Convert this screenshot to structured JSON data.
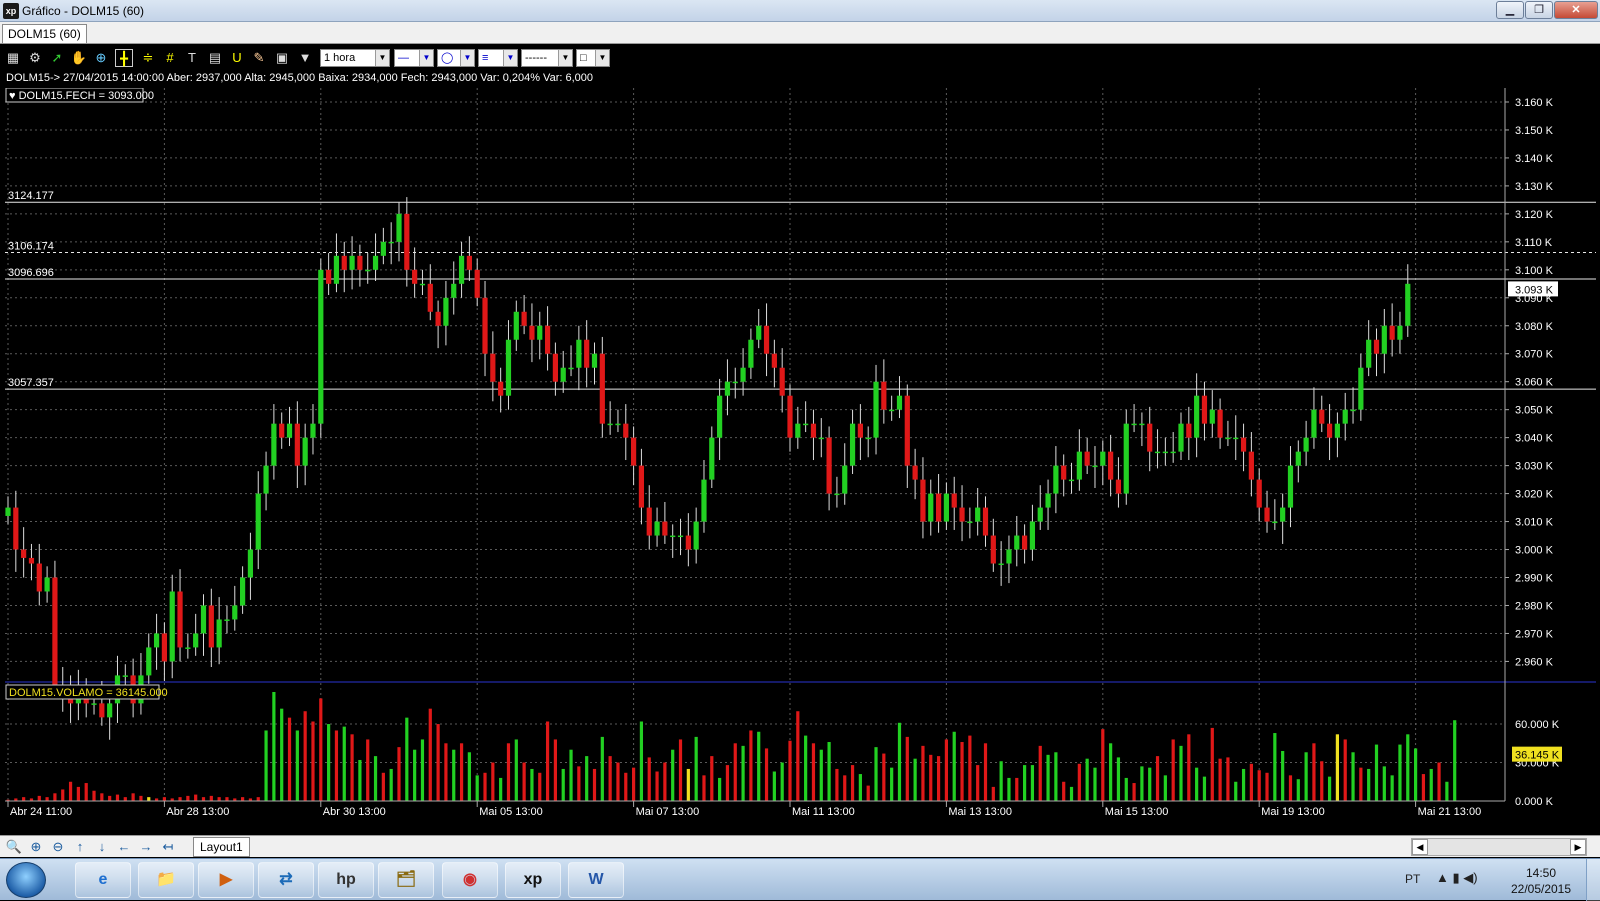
{
  "window": {
    "title": "Gráfico - DOLM15 (60)",
    "app_icon": "xp",
    "min": "▁",
    "max": "❐",
    "close": "✕"
  },
  "tabs": {
    "active": "DOLM15 (60)"
  },
  "toolbar": {
    "icons": [
      "chart-icon",
      "gear-icon",
      "cursor-icon",
      "hand-icon",
      "zoom-area-icon",
      "crosshair-icon",
      "hline-icon",
      "grid-icon",
      "text-icon",
      "calculator-icon",
      "magnet-icon",
      "pencil-icon",
      "lock-icon",
      "filter-icon"
    ],
    "period": "1 hora",
    "line_style": "—",
    "shape": "◯",
    "fill": "≡",
    "dash": "------",
    "color": "□"
  },
  "info_line": "DOLM15-> 27/04/2015 14:00:00 Aber: 2937,000 Alta: 2945,000 Baixa: 2934,000 Fech: 2943,000 Var: 0,204% Var: 6,000",
  "price_legend": "DOLM15.FECH = 3093.000",
  "volume_legend": "DOLM15.VOLAMO = 36145.000",
  "colors": {
    "up": "#22d022",
    "down": "#e01818",
    "neutral": "#f0e020",
    "grid": "#5a5a5a",
    "separator": "#2a34d0"
  },
  "levels": [
    {
      "value": 3124.177,
      "label": "3124.177",
      "style": "solid"
    },
    {
      "value": 3106.174,
      "label": "3106.174",
      "style": "dashed"
    },
    {
      "value": 3096.696,
      "label": "3096.696",
      "style": "solid"
    },
    {
      "value": 3057.357,
      "label": "3057.357",
      "style": "solid"
    }
  ],
  "chart_data": {
    "type": "candlestick",
    "price_axis": {
      "range": [
        2953,
        3165
      ],
      "ticks": [
        2960,
        2970,
        2980,
        2990,
        3000,
        3010,
        3020,
        3030,
        3040,
        3050,
        3060,
        3070,
        3080,
        3090,
        3100,
        3110,
        3120,
        3130,
        3140,
        3150,
        3160
      ],
      "tick_labels": [
        "2.960 K",
        "2.970 K",
        "2.980 K",
        "2.990 K",
        "3.000 K",
        "3.010 K",
        "3.020 K",
        "3.030 K",
        "3.040 K",
        "3.050 K",
        "3.060 K",
        "3.070 K",
        "3.080 K",
        "3.090 K",
        "3.100 K",
        "3.110 K",
        "3.120 K",
        "3.130 K",
        "3.140 K",
        "3.150 K",
        "3.160 K"
      ],
      "current": 3093,
      "current_label": "3.093 K"
    },
    "volume_axis": {
      "range": [
        0,
        85000
      ],
      "ticks": [
        0,
        30000,
        60000
      ],
      "tick_labels": [
        "0.000 K",
        "30.000 K",
        "60.000 K"
      ],
      "current": 36145,
      "current_label": "36.145 K"
    },
    "x_labels": [
      "Abr 24 11:00",
      "Abr 28 13:00",
      "Abr 30 13:00",
      "Mai 05 13:00",
      "Mai 07 13:00",
      "Mai 11 13:00",
      "Mai 13 13:00",
      "Mai 15 13:00",
      "Mai 19 13:00",
      "Mai 21 13:00"
    ],
    "x_label_bars": [
      0,
      20,
      40,
      60,
      80,
      100,
      120,
      140,
      160,
      180
    ],
    "closes": [
      3015,
      3000,
      2997,
      2995,
      2985,
      2990,
      2950,
      2950,
      2945,
      2950,
      2945,
      2945,
      2940,
      2945,
      2955,
      2955,
      2945,
      2955,
      2965,
      2970,
      2960,
      2985,
      2965,
      2965,
      2970,
      2980,
      2965,
      2975,
      2975,
      2980,
      2990,
      3000,
      3020,
      3030,
      3045,
      3040,
      3045,
      3030,
      3040,
      3045,
      3100,
      3095,
      3105,
      3100,
      3105,
      3100,
      3100,
      3105,
      3110,
      3110,
      3120,
      3100,
      3095,
      3095,
      3085,
      3080,
      3090,
      3095,
      3105,
      3100,
      3090,
      3070,
      3060,
      3055,
      3075,
      3085,
      3080,
      3075,
      3080,
      3070,
      3060,
      3065,
      3065,
      3075,
      3065,
      3070,
      3045,
      3045,
      3045,
      3040,
      3030,
      3015,
      3005,
      3010,
      3005,
      3005,
      3005,
      3000,
      3010,
      3025,
      3040,
      3055,
      3060,
      3060,
      3065,
      3075,
      3080,
      3070,
      3065,
      3055,
      3040,
      3045,
      3045,
      3040,
      3040,
      3020,
      3020,
      3030,
      3045,
      3040,
      3040,
      3060,
      3050,
      3050,
      3055,
      3030,
      3025,
      3010,
      3020,
      3010,
      3020,
      3015,
      3010,
      3010,
      3015,
      3005,
      2995,
      2995,
      3000,
      3005,
      3000,
      3010,
      3015,
      3020,
      3030,
      3025,
      3025,
      3035,
      3030,
      3030,
      3035,
      3025,
      3020,
      3045,
      3045,
      3045,
      3035,
      3035,
      3035,
      3035,
      3045,
      3040,
      3055,
      3045,
      3050,
      3040,
      3040,
      3040,
      3035,
      3025,
      3015,
      3010,
      3010,
      3015,
      3030,
      3035,
      3040,
      3050,
      3045,
      3040,
      3045,
      3050,
      3050,
      3065,
      3075,
      3070,
      3080,
      3075,
      3080,
      3095
    ],
    "volumes": [
      1000,
      2000,
      3000,
      2000,
      4000,
      3000,
      6000,
      9000,
      15000,
      11000,
      14000,
      8000,
      6000,
      4000,
      5000,
      3000,
      6000,
      4000,
      3000,
      2000,
      3000,
      2000,
      3000,
      4000,
      5000,
      3000,
      4000,
      3000,
      3000,
      2000,
      3000,
      2000,
      3000,
      55000,
      85000,
      72000,
      65000,
      55000,
      70000,
      62000,
      80000,
      60000,
      55000,
      58000,
      52000,
      32000,
      48000,
      35000,
      22000,
      25000,
      42000,
      65000,
      40000,
      48000,
      72000,
      60000,
      45000,
      40000,
      45000,
      38000,
      20000,
      22000,
      30000,
      18000,
      45000,
      48000,
      30000,
      25000,
      22000,
      62000,
      48000,
      25000,
      40000,
      27000,
      35000,
      25000,
      50000,
      35000,
      30000,
      22000,
      26000,
      62000,
      34000,
      23000,
      30000,
      40000,
      48000,
      25000,
      50000,
      20000,
      35000,
      18000,
      28000,
      45000,
      43000,
      55000,
      54000,
      41000,
      23000,
      30000,
      47000,
      70000,
      51000,
      45000,
      40000,
      46000,
      25000,
      20000,
      28000,
      21000,
      12000,
      42000,
      37000,
      26000,
      61000,
      50000,
      33000,
      43000,
      36000,
      35000,
      48000,
      54000,
      46000,
      51000,
      28000,
      45000,
      11000,
      31000,
      18000,
      18000,
      28000,
      28000,
      43000,
      36000,
      38000,
      15000,
      11000,
      29000,
      33000,
      26000,
      56000,
      45000,
      34000,
      18000,
      14000,
      27000,
      26000,
      35000,
      20000,
      48000,
      43000,
      52000,
      26000,
      19000,
      57000,
      33000,
      34000,
      15000,
      25000,
      29000,
      24000,
      22000,
      53000,
      39000,
      20000,
      17000,
      38000,
      45000,
      31000,
      19000,
      52000,
      48000,
      38000,
      26000,
      25000,
      44000,
      27000,
      20000,
      44000,
      52000,
      41000,
      21000,
      25000,
      30000,
      15000,
      63000
    ],
    "volume_color": [
      "n",
      "n",
      "n",
      "n",
      "n",
      "n",
      "n",
      "n",
      "n",
      "n",
      "n",
      "n",
      "n",
      "n",
      "n",
      "n",
      "n",
      "n",
      "n",
      "n",
      "n",
      "n",
      "n",
      "n",
      "n",
      "n",
      "n",
      "n",
      "n",
      "n",
      "n",
      "n",
      "n",
      "u",
      "u",
      "u",
      "d",
      "u",
      "d",
      "d",
      "d",
      "u",
      "d",
      "u",
      "d",
      "u",
      "d",
      "u",
      "d",
      "u",
      "d",
      "u",
      "u",
      "u",
      "d",
      "d",
      "d",
      "u",
      "d",
      "u",
      "u",
      "d",
      "d",
      "u",
      "d",
      "u",
      "d",
      "u",
      "d",
      "d",
      "d",
      "u",
      "u",
      "d",
      "u",
      "d",
      "u",
      "d",
      "d",
      "d",
      "d",
      "u",
      "d",
      "d",
      "d",
      "u",
      "d",
      "u",
      "u",
      "d",
      "d",
      "u",
      "d",
      "d",
      "u",
      "d",
      "u",
      "d",
      "u",
      "u",
      "d",
      "d",
      "u",
      "d",
      "u",
      "u",
      "d",
      "d",
      "d",
      "u",
      "d",
      "u",
      "d",
      "u",
      "u",
      "d",
      "u",
      "d",
      "d",
      "d",
      "d",
      "u",
      "d",
      "d",
      "d",
      "d",
      "d",
      "u",
      "u",
      "d",
      "u",
      "u",
      "d",
      "u",
      "u",
      "d",
      "u",
      "d",
      "u",
      "u",
      "d",
      "u",
      "u",
      "u",
      "d",
      "u",
      "u",
      "d",
      "u",
      "d",
      "u",
      "d",
      "u",
      "u",
      "d",
      "d",
      "d",
      "u",
      "u",
      "d",
      "d",
      "d",
      "u",
      "u",
      "d",
      "u",
      "u",
      "d",
      "d",
      "u",
      "u",
      "d",
      "u",
      "d",
      "u",
      "u",
      "u",
      "u",
      "u",
      "u",
      "u",
      "d",
      "u",
      "d",
      "u",
      "u",
      "u",
      "u"
    ]
  },
  "bottom": {
    "tools": [
      "zoom-icon",
      "zoom-in-icon",
      "zoom-out-icon",
      "arrow-up-icon",
      "arrow-down-icon",
      "arrow-left-icon",
      "arrow-right-icon",
      "arrow-last-icon"
    ],
    "tool_glyphs": [
      "🔍",
      "⊕",
      "⊖",
      "↑",
      "↓",
      "←",
      "→",
      "↤"
    ],
    "layout_tab": "Layout1",
    "scroll_left": "◀",
    "scroll_right": "▶"
  },
  "taskbar": {
    "apps": [
      "internet-explorer-icon",
      "file-explorer-icon",
      "media-player-icon",
      "network-icon",
      "hp-icon",
      "archive-icon",
      "chrome-icon",
      "xp-app-icon",
      "word-icon"
    ],
    "app_glyphs": [
      "e",
      "📁",
      "▶",
      "⇄",
      "hp",
      "🗂",
      "◉",
      "xp",
      "W"
    ],
    "language": "PT",
    "time": "14:50",
    "date": "22/05/2015"
  }
}
